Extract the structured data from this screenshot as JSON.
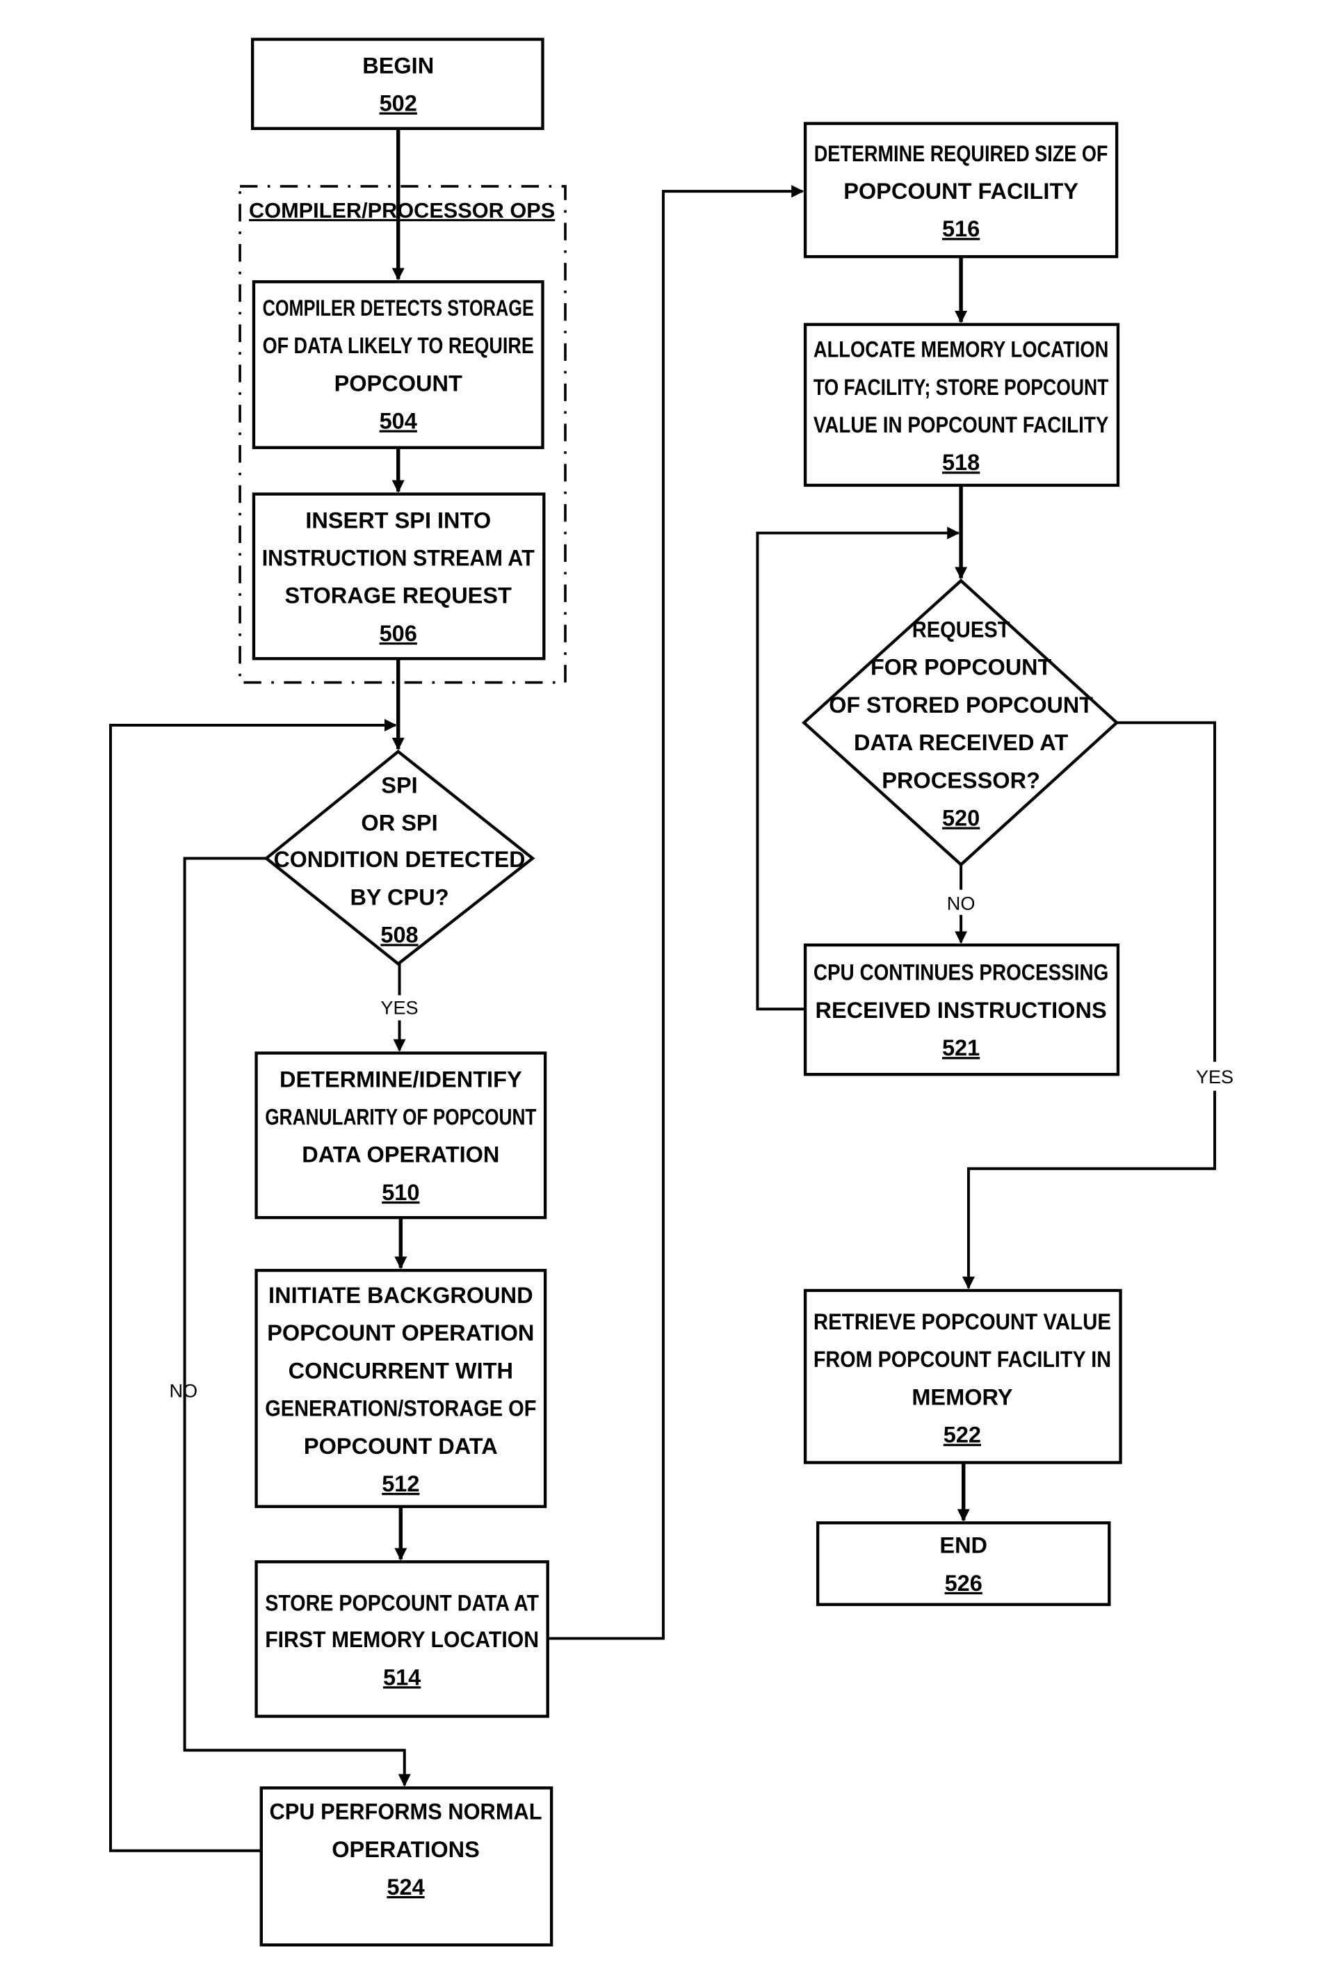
{
  "figure": {
    "group_label": "COMPILER/PROCESSOR OPS",
    "nodes": {
      "n502": {
        "type": "terminal",
        "lines": [
          "BEGIN"
        ],
        "ref": "502"
      },
      "n504": {
        "type": "process",
        "lines": [
          "COMPILER DETECTS STORAGE",
          "OF DATA LIKELY TO REQUIRE",
          "POPCOUNT"
        ],
        "ref": "504"
      },
      "n506": {
        "type": "process",
        "lines": [
          "INSERT SPI INTO",
          "INSTRUCTION STREAM AT",
          "STORAGE REQUEST"
        ],
        "ref": "506"
      },
      "n508": {
        "type": "decision",
        "lines": [
          "SPI",
          "OR SPI",
          "CONDITION DETECTED",
          "BY CPU?"
        ],
        "ref": "508"
      },
      "n510": {
        "type": "process",
        "lines": [
          "DETERMINE/IDENTIFY",
          "GRANULARITY OF POPCOUNT",
          "DATA OPERATION"
        ],
        "ref": "510"
      },
      "n512": {
        "type": "process",
        "lines": [
          "INITIATE BACKGROUND",
          "POPCOUNT OPERATION",
          "CONCURRENT WITH",
          "GENERATION/STORAGE OF",
          "POPCOUNT DATA"
        ],
        "ref": "512"
      },
      "n514": {
        "type": "process",
        "lines": [
          "STORE POPCOUNT DATA AT",
          "FIRST MEMORY LOCATION"
        ],
        "ref": "514"
      },
      "n524": {
        "type": "process",
        "lines": [
          "CPU PERFORMS NORMAL",
          "OPERATIONS"
        ],
        "ref": "524"
      },
      "n516": {
        "type": "process",
        "lines": [
          "DETERMINE REQUIRED SIZE OF",
          "POPCOUNT FACILITY"
        ],
        "ref": "516"
      },
      "n518": {
        "type": "process",
        "lines": [
          "ALLOCATE MEMORY LOCATION",
          "TO FACILITY; STORE POPCOUNT",
          "VALUE IN POPCOUNT FACILITY"
        ],
        "ref": "518"
      },
      "n520": {
        "type": "decision",
        "lines": [
          "REQUEST",
          "FOR POPCOUNT",
          "OF STORED POPCOUNT",
          "DATA RECEIVED AT",
          "PROCESSOR?"
        ],
        "ref": "520"
      },
      "n521": {
        "type": "process",
        "lines": [
          "CPU CONTINUES PROCESSING",
          "RECEIVED INSTRUCTIONS"
        ],
        "ref": "521"
      },
      "n522": {
        "type": "process",
        "lines": [
          "RETRIEVE POPCOUNT VALUE",
          "FROM POPCOUNT FACILITY IN",
          "MEMORY"
        ],
        "ref": "522"
      },
      "n526": {
        "type": "terminal",
        "lines": [
          "END"
        ],
        "ref": "526"
      }
    },
    "branch_labels": {
      "b508_yes": "YES",
      "b508_no": "NO",
      "b520_no": "NO",
      "b520_yes": "YES"
    }
  }
}
